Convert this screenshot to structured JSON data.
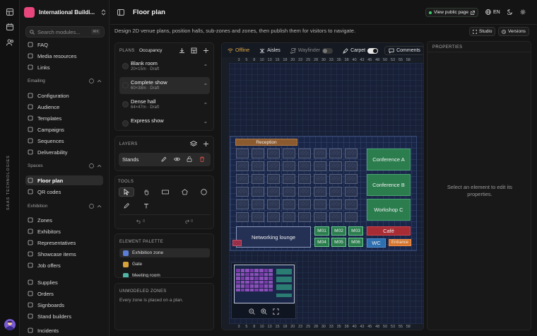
{
  "rail": {
    "icons": [
      "grid-icon",
      "calendar-icon",
      "users-icon"
    ],
    "vertical_label": "SAAS TECHNOLOGIES"
  },
  "sidebar": {
    "org_name": "International Buildi...",
    "search_placeholder": "Search modules...",
    "search_shortcut": "⌘K",
    "top_items": [
      {
        "label": "FAQ",
        "icon": "help-icon"
      },
      {
        "label": "Media resources",
        "icon": "image-icon"
      },
      {
        "label": "Links",
        "icon": "link-icon"
      }
    ],
    "sections": [
      {
        "title": "Emailing",
        "items": [
          {
            "label": "Configuration",
            "icon": "settings-icon"
          },
          {
            "label": "Audience",
            "icon": "users-icon"
          },
          {
            "label": "Templates",
            "icon": "file-icon"
          },
          {
            "label": "Campaigns",
            "icon": "mail-icon"
          },
          {
            "label": "Sequences",
            "icon": "list-icon"
          },
          {
            "label": "Deliverability",
            "icon": "chart-icon"
          }
        ]
      },
      {
        "title": "Spaces",
        "items": [
          {
            "label": "Floor plan",
            "icon": "map-icon",
            "active": true
          },
          {
            "label": "QR codes",
            "icon": "qr-icon"
          }
        ]
      },
      {
        "title": "Exhibition",
        "items": [
          {
            "label": "Zones",
            "icon": "grid-icon"
          },
          {
            "label": "Exhibitors",
            "icon": "building-icon"
          },
          {
            "label": "Representatives",
            "icon": "user-icon"
          },
          {
            "label": "Showcase items",
            "icon": "box-icon"
          },
          {
            "label": "Job offers",
            "icon": "briefcase-icon"
          }
        ]
      },
      {
        "title": "",
        "items": [
          {
            "label": "Supplies",
            "icon": "box-icon"
          },
          {
            "label": "Orders",
            "icon": "cart-icon"
          },
          {
            "label": "Signboards",
            "icon": "sign-icon"
          },
          {
            "label": "Stand builders",
            "icon": "hammer-icon"
          },
          {
            "label": "Incidents",
            "icon": "alert-icon"
          }
        ]
      }
    ]
  },
  "topbar": {
    "title": "Floor plan",
    "view_public": "View public page",
    "language": "EN",
    "studio": "Studio",
    "versions": "Versions"
  },
  "subtitle": "Design 2D venue plans, position halls, sub-zones and zones, then publish them for visitors to navigate.",
  "plans_panel": {
    "title": "PLANS",
    "badge": "Occupancy",
    "items": [
      {
        "name": "Blank room",
        "meta": "20×15m",
        "status": "Draft",
        "selected": false
      },
      {
        "name": "Complete show",
        "meta": "60×38m",
        "status": "Draft",
        "selected": true
      },
      {
        "name": "Dense hall",
        "meta": "64×47m",
        "status": "Draft",
        "selected": false
      },
      {
        "name": "Express show",
        "meta": "",
        "status": "",
        "selected": false
      }
    ]
  },
  "layers_panel": {
    "title": "LAYERS",
    "items": [
      {
        "name": "Stands"
      }
    ]
  },
  "tools_panel": {
    "title": "TOOLS",
    "undo_count": "0",
    "redo_count": "0"
  },
  "palette_panel": {
    "title": "ELEMENT PALETTE",
    "items": [
      {
        "label": "Exhibition zone",
        "color": "#5b7fd6"
      },
      {
        "label": "Gate",
        "color": "#d6a23a"
      },
      {
        "label": "Meeting room",
        "color": "#4fb6a6"
      }
    ]
  },
  "unmodeled_panel": {
    "title": "UNMODELED ZONES",
    "text": "Every zone is placed on a plan."
  },
  "canvas_toolbar": {
    "offline": "Offline",
    "aisles": "Aisles",
    "wayfinder": "Wayfinder",
    "carpet": "Carpet",
    "comments": "Comments"
  },
  "ruler": {
    "ticks": [
      "3",
      "5",
      "8",
      "10",
      "13",
      "15",
      "18",
      "20",
      "23",
      "25",
      "28",
      "30",
      "33",
      "35",
      "38",
      "40",
      "43",
      "45",
      "48",
      "50",
      "53",
      "55",
      "58"
    ]
  },
  "floor": {
    "reception": "Reception",
    "conference_a": "Conference A",
    "conference_b": "Conference B",
    "workshop_c": "Workshop C",
    "lounge": "Networking lounge",
    "cafe": "Café",
    "wc": "WC",
    "entrance": "Entrance",
    "meeting_rooms": [
      "M01",
      "M02",
      "M03",
      "M04",
      "M05",
      "M06"
    ],
    "colors": {
      "accent_green": "#2b7d4e",
      "cafe": "#a82c33",
      "wc": "#2e6fb0",
      "entrance": "#d5742a",
      "reception": "#8c5a2f"
    }
  },
  "properties": {
    "title": "PROPERTIES",
    "empty_text": "Select an element to edit its properties."
  }
}
